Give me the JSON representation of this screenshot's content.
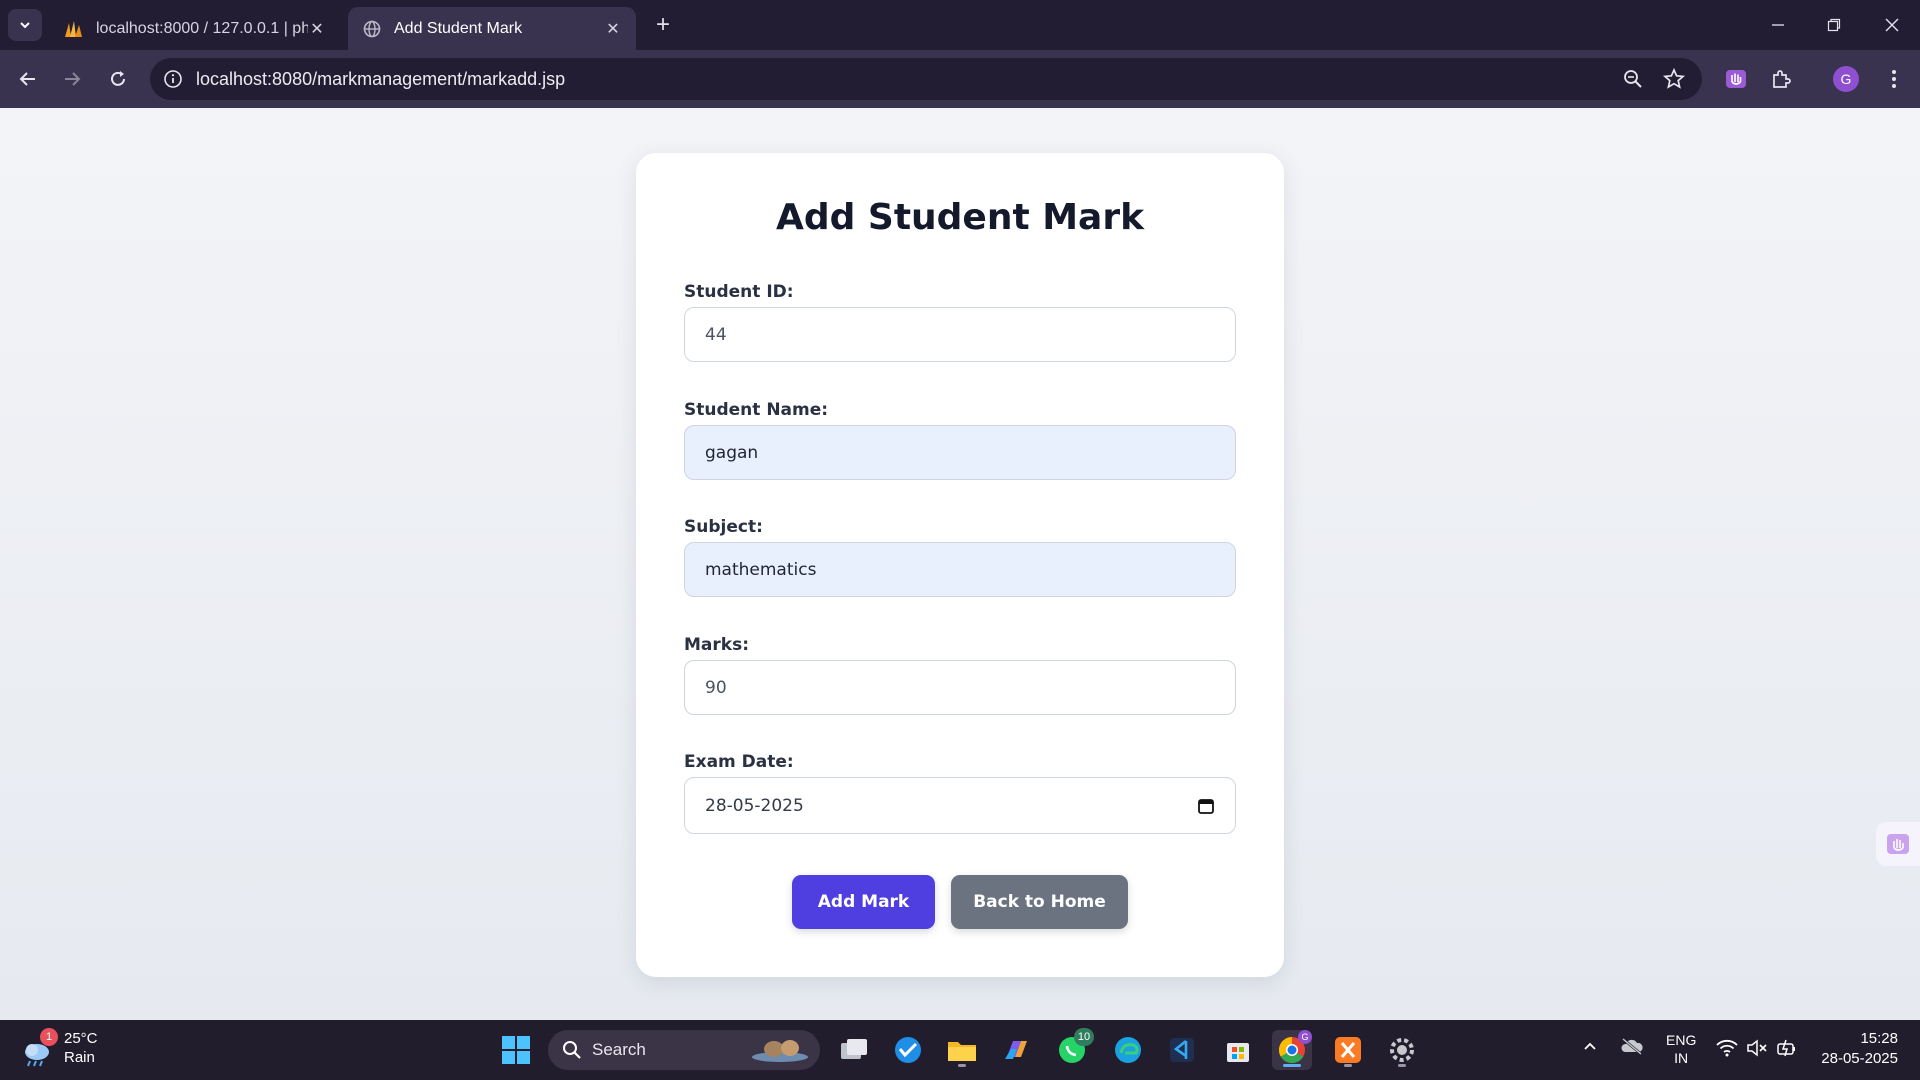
{
  "browser": {
    "tabs": [
      {
        "title": "localhost:8000 / 127.0.0.1 | phpMyAdmin",
        "active": false
      },
      {
        "title": "Add Student Mark",
        "active": true
      }
    ],
    "url": "localhost:8080/markmanagement/markadd.jsp",
    "profile_initial": "G"
  },
  "form": {
    "title": "Add Student Mark",
    "student_id_label": "Student ID:",
    "student_id_value": "44",
    "student_name_label": "Student Name:",
    "student_name_value": "gagan",
    "subject_label": "Subject:",
    "subject_value": "mathematics",
    "marks_label": "Marks:",
    "marks_value": "90",
    "exam_date_label": "Exam Date:",
    "exam_date_value": "28-05-2025",
    "add_button": "Add Mark",
    "back_button": "Back to Home"
  },
  "taskbar": {
    "weather_temp": "25°C",
    "weather_desc": "Rain",
    "weather_badge": "1",
    "search_label": "Search",
    "whatsapp_badge": "10",
    "language_line1": "ENG",
    "language_line2": "IN",
    "time": "15:28",
    "date": "28-05-2025"
  },
  "colors": {
    "primary_button": "#4f3fe0",
    "secondary_button": "#6b7280",
    "autofill_bg": "#e8f0fe",
    "chrome_dark": "#231d33"
  }
}
